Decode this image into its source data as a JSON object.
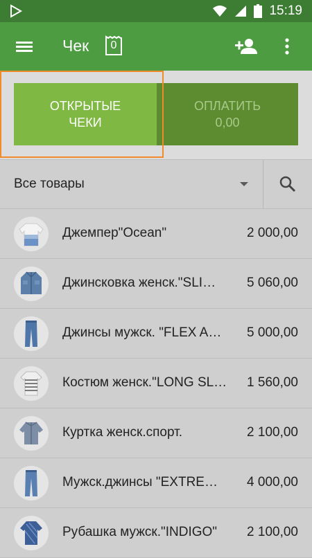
{
  "status_bar": {
    "time": "15:19"
  },
  "toolbar": {
    "title": "Чек",
    "ticket_count": "0"
  },
  "buttons": {
    "open_checks": [
      "ОТКРЫТЫЕ",
      "ЧЕКИ"
    ],
    "pay_label": "ОПЛАТИТЬ",
    "pay_amount": "0,00"
  },
  "filter": {
    "category": "Все товары"
  },
  "products": [
    {
      "name": "Джемпер\"Ocean\"",
      "price": "2 000,00",
      "icon": "sweater-icon"
    },
    {
      "name": "Джинсковка женск.\"SLI…",
      "price": "5 060,00",
      "icon": "denim-shirt-icon"
    },
    {
      "name": "Джинсы мужск. \"FLEX A…",
      "price": "5 000,00",
      "icon": "jeans-icon"
    },
    {
      "name": "Костюм женск.\"LONG SL…",
      "price": "1 560,00",
      "icon": "striped-top-icon"
    },
    {
      "name": "Куртка женск.спорт.",
      "price": "2 100,00",
      "icon": "jacket-icon"
    },
    {
      "name": "Мужск.джинсы \"EXTRE…",
      "price": "4 000,00",
      "icon": "jeans-icon"
    },
    {
      "name": "Рубашка мужск.\"INDIGO\"",
      "price": "2 100,00",
      "icon": "shirt-icon"
    }
  ]
}
